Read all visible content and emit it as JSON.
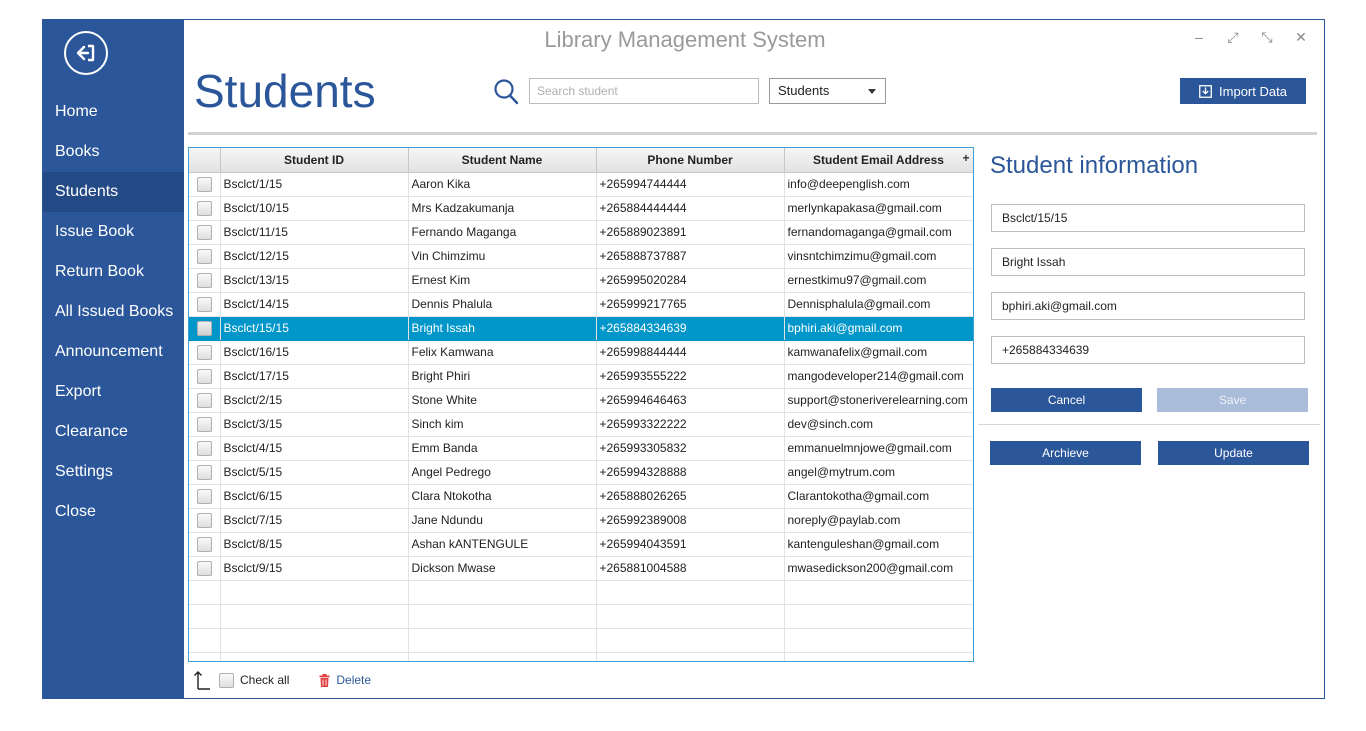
{
  "window": {
    "title": "Library Management System",
    "controls": [
      "–",
      "⤢",
      "⤡",
      "✕"
    ]
  },
  "sidebar": {
    "items": [
      {
        "label": "Home"
      },
      {
        "label": "Books"
      },
      {
        "label": "Students",
        "active": true
      },
      {
        "label": "Issue Book"
      },
      {
        "label": "Return Book"
      },
      {
        "label": "All Issued Books"
      },
      {
        "label": "Announcement"
      },
      {
        "label": "Export"
      },
      {
        "label": "Clearance"
      },
      {
        "label": "Settings"
      },
      {
        "label": "Close"
      }
    ]
  },
  "header": {
    "page_title": "Students",
    "search_placeholder": "Search student",
    "filter_value": "Students",
    "import_label": "Import Data"
  },
  "table": {
    "columns": [
      "Student ID",
      "Student Name",
      "Phone  Number",
      "Student Email Address"
    ],
    "add_column_label": "+",
    "selected_index": 6,
    "rows": [
      [
        "Bsclct/1/15",
        "Aaron Kika",
        "+265994744444",
        "info@deepenglish.com"
      ],
      [
        "Bsclct/10/15",
        "Mrs Kadzakumanja",
        "+265884444444",
        "merlynkapakasa@gmail.com"
      ],
      [
        "Bsclct/11/15",
        "Fernando Maganga",
        "+265889023891",
        "fernandomaganga@gmail.com"
      ],
      [
        "Bsclct/12/15",
        "Vin Chimzimu",
        "+265888737887",
        "vinsntchimzimu@gmail.com"
      ],
      [
        "Bsclct/13/15",
        "Ernest Kim",
        "+265995020284",
        "ernestkimu97@gmail.com"
      ],
      [
        "Bsclct/14/15",
        "Dennis Phalula",
        "+265999217765",
        "Dennisphalula@gmail.com"
      ],
      [
        "Bsclct/15/15",
        "Bright Issah",
        "+265884334639",
        "bphiri.aki@gmail.com"
      ],
      [
        "Bsclct/16/15",
        "Felix Kamwana",
        "+265998844444",
        "kamwanafelix@gmail.com"
      ],
      [
        "Bsclct/17/15",
        "Bright Phiri",
        "+265993555222",
        "mangodeveloper214@gmail.com"
      ],
      [
        "Bsclct/2/15",
        "Stone White",
        "+265994646463",
        "support@stoneriverelearning.com"
      ],
      [
        "Bsclct/3/15",
        "Sinch kim",
        "+265993322222",
        "dev@sinch.com"
      ],
      [
        "Bsclct/4/15",
        "Emm Banda",
        "+265993305832",
        "emmanuelmnjowe@gmail.com"
      ],
      [
        "Bsclct/5/15",
        "Angel Pedrego",
        "+265994328888",
        "angel@mytrum.com"
      ],
      [
        "Bsclct/6/15",
        "Clara Ntokotha",
        "+265888026265",
        "Clarantokotha@gmail.com"
      ],
      [
        "Bsclct/7/15",
        "Jane Ndundu",
        "+265992389008",
        "noreply@paylab.com"
      ],
      [
        "Bsclct/8/15",
        "Ashan kANTENGULE",
        "+265994043591",
        "kantenguleshan@gmail.com"
      ],
      [
        "Bsclct/9/15",
        "Dickson Mwase",
        "+265881004588",
        "mwasedickson200@gmail.com"
      ]
    ]
  },
  "footer": {
    "check_all_label": "Check all",
    "delete_label": "Delete"
  },
  "panel": {
    "title": "Student information",
    "student_id": "Bsclct/15/15",
    "student_name": "Bright Issah",
    "email": "bphiri.aki@gmail.com",
    "phone": "+265884334639",
    "cancel_label": "Cancel",
    "save_label": "Save",
    "archive_label": "Archieve",
    "update_label": "Update"
  },
  "colors": {
    "brand": "#2b579a",
    "selection": "#0096c9",
    "disabled": "#a9bcd9"
  }
}
